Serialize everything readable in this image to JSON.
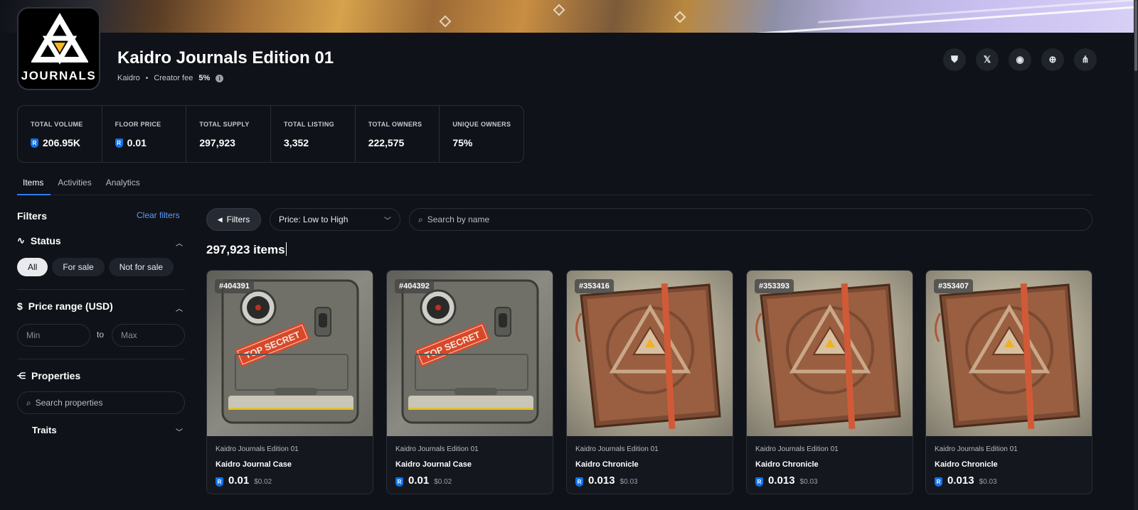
{
  "collection": {
    "logo_text": "JOURNALS",
    "title": "Kaidro Journals Edition 01",
    "creator": "Kaidro",
    "creator_fee_label": "Creator fee",
    "creator_fee_value": "5%"
  },
  "socials": [
    {
      "icon": "shield-icon",
      "glyph": "⛊"
    },
    {
      "icon": "x-icon",
      "glyph": "𝕏"
    },
    {
      "icon": "discord-icon",
      "glyph": "◉"
    },
    {
      "icon": "globe-icon",
      "glyph": "⊕"
    },
    {
      "icon": "share-icon",
      "glyph": "⋔"
    }
  ],
  "stats": [
    {
      "label": "TOTAL VOLUME",
      "value": "206.95K",
      "ron": true
    },
    {
      "label": "FLOOR PRICE",
      "value": "0.01",
      "ron": true
    },
    {
      "label": "TOTAL SUPPLY",
      "value": "297,923",
      "ron": false
    },
    {
      "label": "TOTAL LISTING",
      "value": "3,352",
      "ron": false
    },
    {
      "label": "TOTAL OWNERS",
      "value": "222,575",
      "ron": false
    },
    {
      "label": "UNIQUE OWNERS",
      "value": "75%",
      "ron": false
    }
  ],
  "tabs": [
    "Items",
    "Activities",
    "Analytics"
  ],
  "sidebar": {
    "title": "Filters",
    "clear": "Clear filters",
    "status_title": "Status",
    "status_options": [
      "All",
      "For sale",
      "Not for sale"
    ],
    "price_title": "Price range (USD)",
    "min_placeholder": "Min",
    "to_label": "to",
    "max_placeholder": "Max",
    "properties_title": "Properties",
    "properties_search": "Search properties",
    "traits": "Traits"
  },
  "toolbar": {
    "filters_label": "Filters",
    "sort_label": "Price: Low to High",
    "search_placeholder": "Search by name"
  },
  "items_count": "297,923 items",
  "cards": [
    {
      "id": "#404391",
      "collection": "Kaidro Journals Edition 01",
      "name": "Kaidro Journal Case",
      "price": "0.01",
      "usd": "$0.02",
      "kind": "case"
    },
    {
      "id": "#404392",
      "collection": "Kaidro Journals Edition 01",
      "name": "Kaidro Journal Case",
      "price": "0.01",
      "usd": "$0.02",
      "kind": "case"
    },
    {
      "id": "#353416",
      "collection": "Kaidro Journals Edition 01",
      "name": "Kaidro Chronicle",
      "price": "0.013",
      "usd": "$0.03",
      "kind": "book"
    },
    {
      "id": "#353393",
      "collection": "Kaidro Journals Edition 01",
      "name": "Kaidro Chronicle",
      "price": "0.013",
      "usd": "$0.03",
      "kind": "book"
    },
    {
      "id": "#353407",
      "collection": "Kaidro Journals Edition 01",
      "name": "Kaidro Chronicle",
      "price": "0.013",
      "usd": "$0.03",
      "kind": "book"
    }
  ],
  "case_label": "TOP SECRET",
  "colors": {
    "accent": "#2f7cf6",
    "link": "#5b9bf8",
    "ron": "#1273ea",
    "background": "#0f1218"
  }
}
